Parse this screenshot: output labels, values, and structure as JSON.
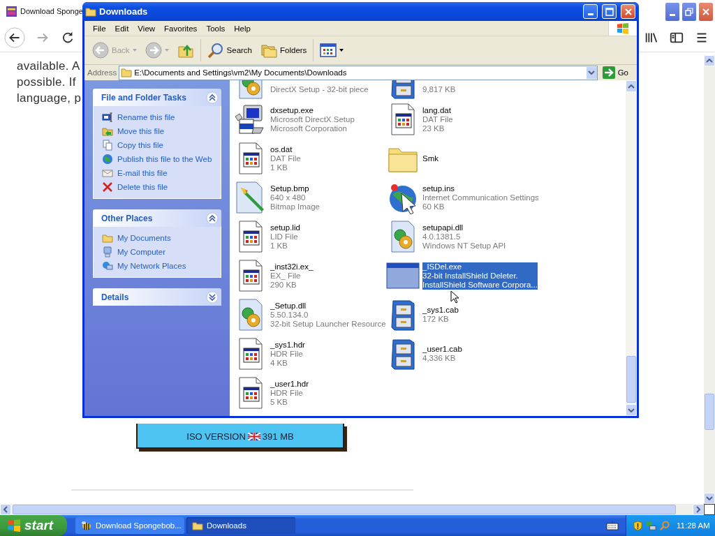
{
  "browser": {
    "tab_title": "Download Sponge",
    "page_lines": [
      "available. A",
      "possible. If",
      "language, p"
    ],
    "banner": {
      "edition": "ISO VERSION",
      "size": "391 MB"
    }
  },
  "explorer": {
    "title": "Downloads",
    "menu": [
      "File",
      "Edit",
      "View",
      "Favorites",
      "Tools",
      "Help"
    ],
    "toolbar": [
      {
        "kind": "back",
        "label": "Back",
        "disabled": true
      },
      {
        "kind": "forward",
        "disabled": true
      },
      {
        "kind": "up"
      },
      {
        "kind": "search",
        "label": "Search"
      },
      {
        "kind": "folders",
        "label": "Folders"
      },
      {
        "kind": "views"
      }
    ],
    "address": {
      "label": "Address",
      "value": "E:\\Documents and Settings\\vm2\\My Documents\\Downloads",
      "go": "Go"
    },
    "panels": [
      {
        "title": "File and Folder Tasks",
        "expanded": true,
        "items": [
          {
            "label": "Rename this file",
            "kind": "rename"
          },
          {
            "label": "Move this file",
            "kind": "move"
          },
          {
            "label": "Copy this file",
            "kind": "copy"
          },
          {
            "label": "Publish this file to the Web",
            "kind": "publish"
          },
          {
            "label": "E-mail this file",
            "kind": "email"
          },
          {
            "label": "Delete this file",
            "kind": "delete"
          }
        ]
      },
      {
        "title": "Other Places",
        "expanded": true,
        "items": [
          {
            "label": "My Documents",
            "kind": "folder"
          },
          {
            "label": "My Computer",
            "kind": "computer"
          },
          {
            "label": "My Network Places",
            "kind": "network"
          }
        ]
      },
      {
        "title": "Details",
        "expanded": false
      }
    ],
    "files": [
      {
        "kind": "gears",
        "cut": true,
        "lines": [
          "DirectX Setup - 32-bit piece"
        ],
        "selected": false
      },
      {
        "kind": "cabinet",
        "cut": true,
        "lines": [
          "9,817 KB"
        ],
        "selected": false
      },
      {
        "kind": "computer",
        "cut": false,
        "lines": [
          "dxsetup.exe",
          "Microsoft DirectX Setup",
          "Microsoft Corporation"
        ],
        "selected": false
      },
      {
        "kind": "document",
        "cut": false,
        "lines": [
          "lang.dat",
          "DAT File",
          "23 KB"
        ],
        "selected": false
      },
      {
        "kind": "document",
        "cut": false,
        "lines": [
          "os.dat",
          "DAT File",
          "1 KB"
        ],
        "selected": false
      },
      {
        "kind": "folder",
        "cut": false,
        "lines": [
          "Smk"
        ],
        "selected": false
      },
      {
        "kind": "brush",
        "cut": false,
        "lines": [
          "Setup.bmp",
          "640 x 480",
          "Bitmap Image"
        ],
        "selected": false
      },
      {
        "kind": "globe",
        "cut": false,
        "lines": [
          "setup.ins",
          "Internet Communication Settings",
          "60 KB"
        ],
        "selected": false
      },
      {
        "kind": "document",
        "cut": false,
        "lines": [
          "setup.lid",
          "LID File",
          "1 KB"
        ],
        "selected": false
      },
      {
        "kind": "gears",
        "cut": false,
        "lines": [
          "setupapi.dll",
          "4.0.1381.5",
          "Windows NT Setup API"
        ],
        "selected": false
      },
      {
        "kind": "document",
        "cut": false,
        "lines": [
          "_inst32i.ex_",
          "EX_ File",
          "290 KB"
        ],
        "selected": false
      },
      {
        "kind": "window",
        "cut": false,
        "lines": [
          "_ISDel.exe",
          "32-bit InstallShield Deleter.",
          "InstallShield Software Corpora..."
        ],
        "selected": true
      },
      {
        "kind": "gears",
        "cut": false,
        "lines": [
          "_Setup.dll",
          "5.50.134.0",
          "32-bit Setup Launcher Resource"
        ],
        "selected": false
      },
      {
        "kind": "cabinet",
        "cut": false,
        "lines": [
          "_sys1.cab",
          "172 KB"
        ],
        "selected": false
      },
      {
        "kind": "document",
        "cut": false,
        "lines": [
          "_sys1.hdr",
          "HDR File",
          "4 KB"
        ],
        "selected": false
      },
      {
        "kind": "cabinet",
        "cut": false,
        "lines": [
          "_user1.cab",
          "4,336 KB"
        ],
        "selected": false
      },
      {
        "kind": "document",
        "cut": false,
        "lines": [
          "_user1.hdr",
          "HDR File",
          "5 KB"
        ],
        "selected": false
      }
    ]
  },
  "taskbar": {
    "start": "start",
    "tasks": [
      {
        "label": "Download Spongebob...",
        "kind": "bee",
        "selected": false
      },
      {
        "label": "Downloads",
        "kind": "folder",
        "selected": true
      }
    ],
    "clock": "11:28 AM"
  }
}
